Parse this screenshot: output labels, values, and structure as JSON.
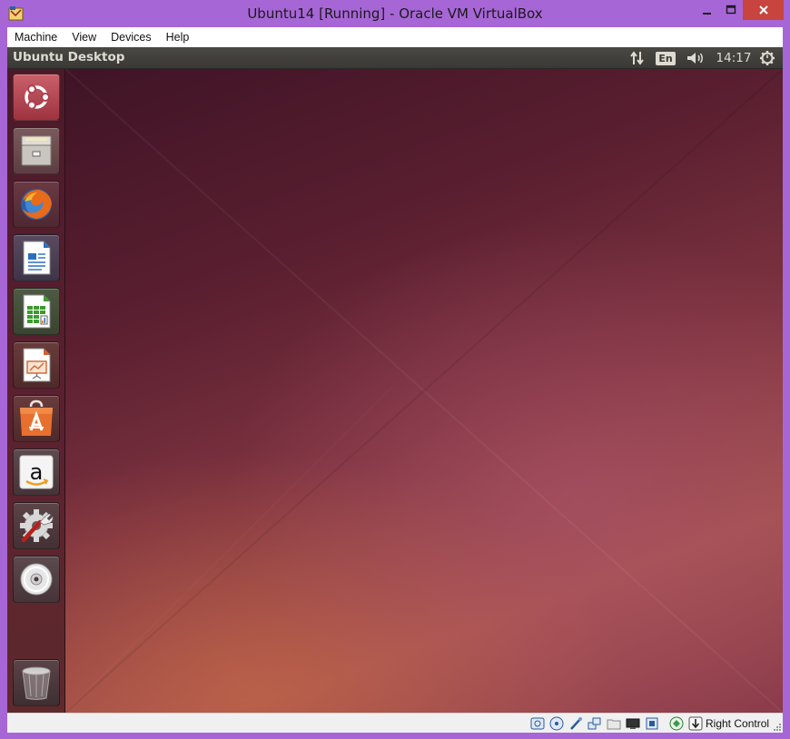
{
  "window": {
    "title": "Ubuntu14 [Running] - Oracle VM VirtualBox"
  },
  "menubar": {
    "items": [
      "Machine",
      "View",
      "Devices",
      "Help"
    ]
  },
  "ubuntu": {
    "panel_title": "Ubuntu Desktop",
    "keyboard_layout": "En",
    "clock": "14:17",
    "launcher": [
      {
        "name": "Dash Home",
        "icon": "ubuntu-logo-icon"
      },
      {
        "name": "Files",
        "icon": "file-cabinet-icon"
      },
      {
        "name": "Firefox Web Browser",
        "icon": "firefox-icon"
      },
      {
        "name": "LibreOffice Writer",
        "icon": "writer-icon"
      },
      {
        "name": "LibreOffice Calc",
        "icon": "calc-icon"
      },
      {
        "name": "LibreOffice Impress",
        "icon": "impress-icon"
      },
      {
        "name": "Ubuntu Software Center",
        "icon": "software-center-icon"
      },
      {
        "name": "Amazon",
        "icon": "amazon-icon"
      },
      {
        "name": "System Settings",
        "icon": "settings-icon"
      },
      {
        "name": "Optical Drive",
        "icon": "cd-icon"
      },
      {
        "name": "Trash",
        "icon": "trash-icon"
      }
    ]
  },
  "statusbar": {
    "host_key": "Right Control",
    "icons": [
      "hard-disk-icon",
      "optical-drive-icon",
      "usb-icon",
      "network-icon",
      "shared-folder-icon",
      "display-icon",
      "video-capture-icon",
      "cpu-virtualization-icon",
      "mouse-integration-icon",
      "keyboard-capture-icon"
    ]
  },
  "colors": {
    "window_frame": "#a766d6",
    "close_button": "#c7443f",
    "launcher": "#5a2030",
    "panel": "#3c3b37"
  }
}
